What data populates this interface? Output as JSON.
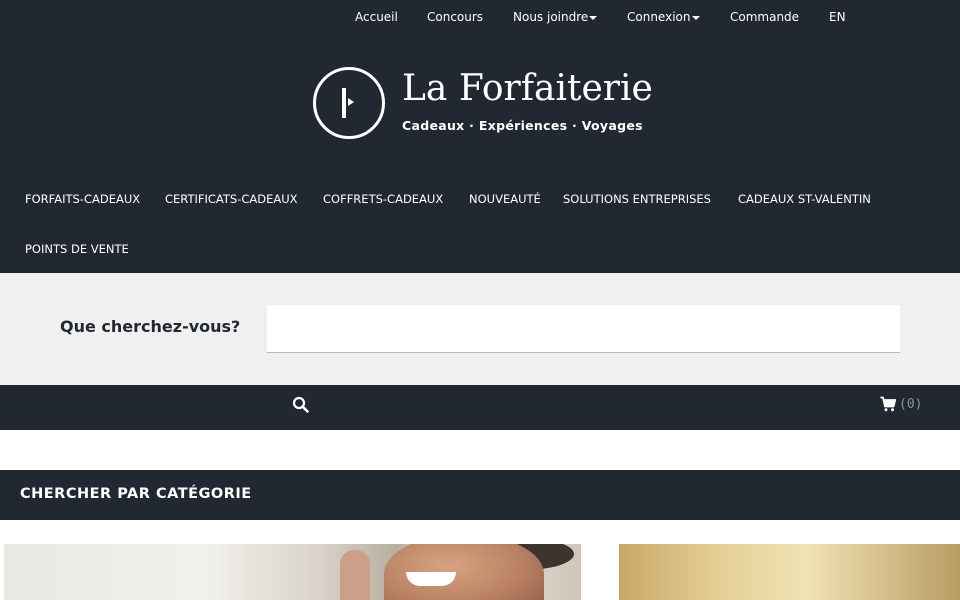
{
  "topnav": {
    "items": [
      {
        "label": "Accueil",
        "dropdown": false
      },
      {
        "label": "Concours",
        "dropdown": false
      },
      {
        "label": "Nous joindre",
        "dropdown": true
      },
      {
        "label": "Connexion",
        "dropdown": true
      },
      {
        "label": "Commande",
        "dropdown": false
      },
      {
        "label": "EN",
        "dropdown": false
      }
    ]
  },
  "logo": {
    "title": "La Forfaiterie",
    "tagline": "Cadeaux · Expériences · Voyages"
  },
  "mainnav": {
    "items": [
      "FORFAITS-CADEAUX",
      "CERTIFICATS-CADEAUX",
      "COFFRETS-CADEAUX",
      "NOUVEAUTÉ",
      "SOLUTIONS ENTREPRISES",
      "CADEAUX ST-VALENTIN",
      "POINTS DE VENTE"
    ]
  },
  "search": {
    "label": "Que cherchez-vous?",
    "value": "",
    "placeholder": ""
  },
  "toolbar": {
    "search_icon": "search-icon",
    "cart_icon": "cart-icon",
    "cart_count": "(0)"
  },
  "categories": {
    "title": "CHERCHER PAR CATÉGORIE"
  },
  "colors": {
    "header_bg": "#222831",
    "search_band_bg": "#f0f0f0",
    "text_on_dark": "#ffffff",
    "cart_count": "#8a8f96"
  }
}
